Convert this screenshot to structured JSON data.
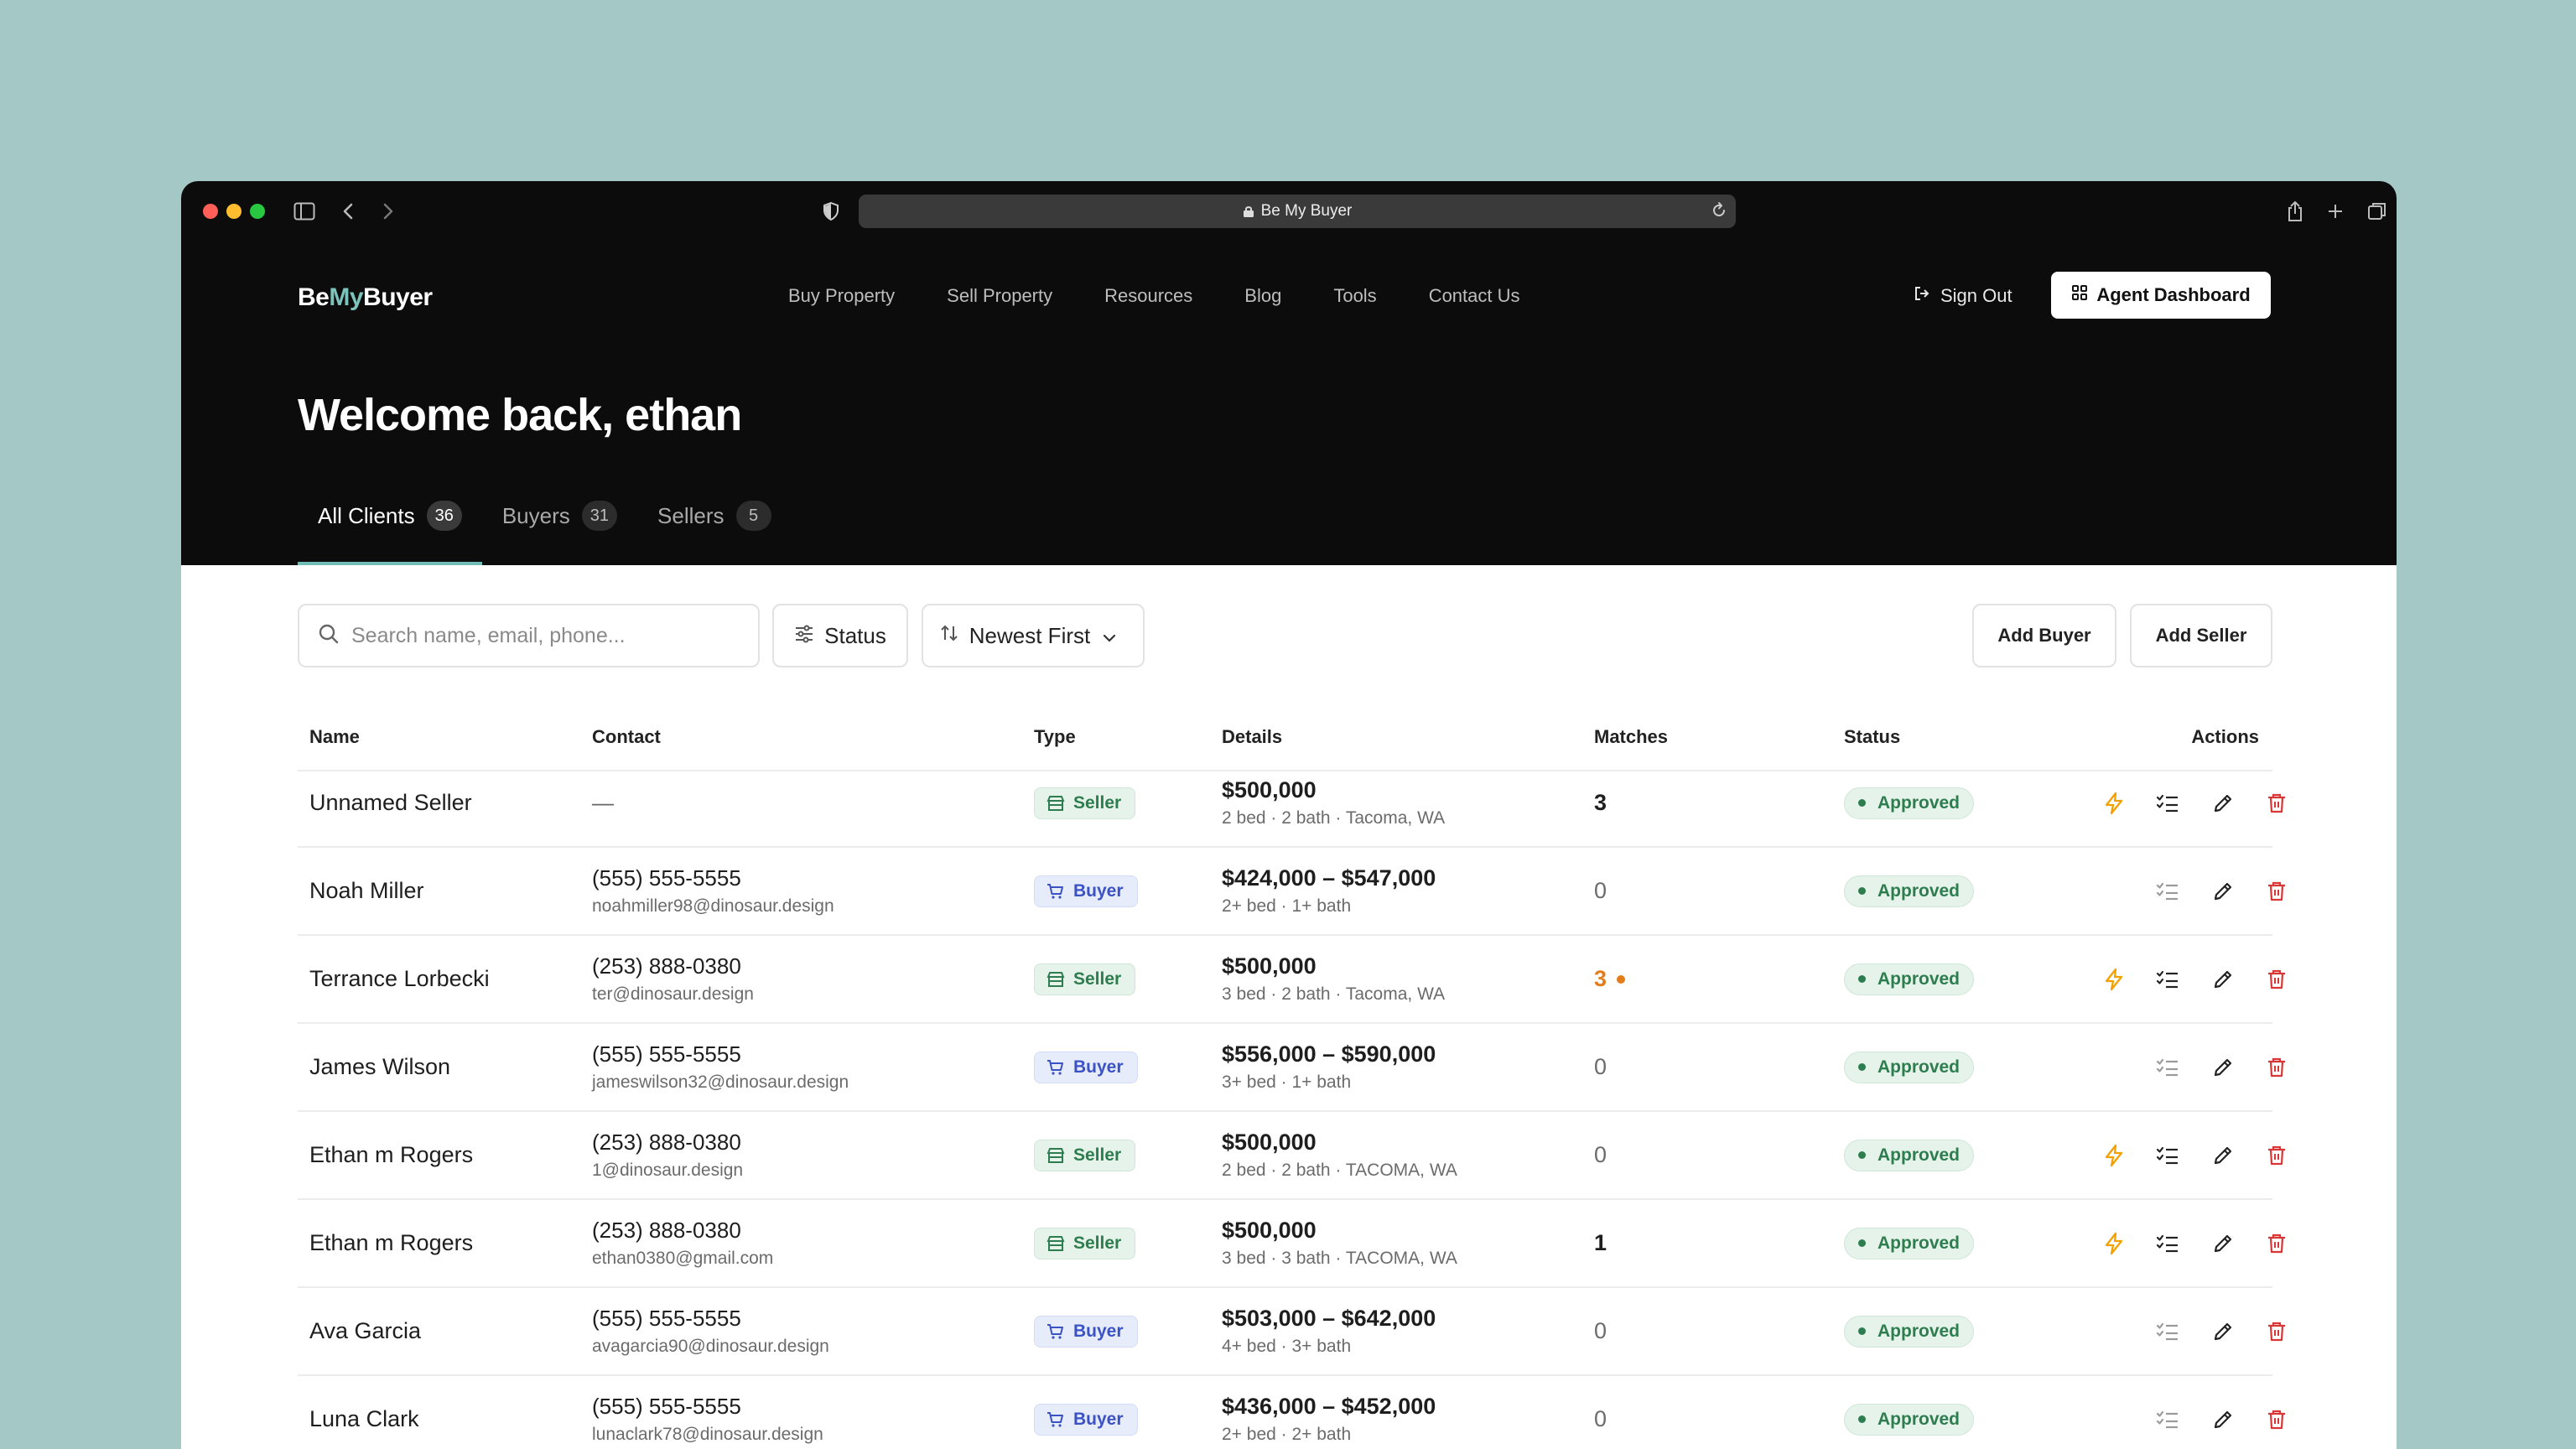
{
  "browser": {
    "url_title": "Be My Buyer"
  },
  "header": {
    "logo": {
      "part1": "Be",
      "part2": "My",
      "part3": "Buyer"
    },
    "nav": [
      "Buy Property",
      "Sell Property",
      "Resources",
      "Blog",
      "Tools",
      "Contact Us"
    ],
    "sign_out": "Sign Out",
    "agent_dashboard": "Agent Dashboard",
    "welcome": "Welcome back, ethan"
  },
  "tabs": [
    {
      "label": "All Clients",
      "count": "36",
      "active": true
    },
    {
      "label": "Buyers",
      "count": "31",
      "active": false
    },
    {
      "label": "Sellers",
      "count": "5",
      "active": false
    }
  ],
  "toolbar": {
    "search_placeholder": "Search name, email, phone...",
    "status_label": "Status",
    "sort_label": "Newest First",
    "add_buyer": "Add Buyer",
    "add_seller": "Add Seller"
  },
  "table": {
    "headers": {
      "name": "Name",
      "contact": "Contact",
      "type": "Type",
      "details": "Details",
      "matches": "Matches",
      "status": "Status",
      "actions": "Actions"
    },
    "rows": [
      {
        "name": "Unnamed Seller",
        "phone": "—",
        "email": "",
        "type": "Seller",
        "price": "$500,000",
        "spec": "2 bed · 2 bath · Tacoma, WA",
        "matches": "3",
        "match_style": "bold",
        "status": "Approved",
        "bolt": true
      },
      {
        "name": "Noah Miller",
        "phone": "(555) 555-5555",
        "email": "noahmiller98@dinosaur.design",
        "type": "Buyer",
        "price": "$424,000 – $547,000",
        "spec": "2+ bed · 1+ bath",
        "matches": "0",
        "match_style": "zero",
        "status": "Approved",
        "bolt": false
      },
      {
        "name": "Terrance Lorbecki",
        "phone": "(253) 888-0380",
        "email": "ter@dinosaur.design",
        "type": "Seller",
        "price": "$500,000",
        "spec": "3 bed · 2 bath · Tacoma, WA",
        "matches": "3",
        "match_style": "orange",
        "status": "Approved",
        "bolt": true
      },
      {
        "name": "James Wilson",
        "phone": "(555) 555-5555",
        "email": "jameswilson32@dinosaur.design",
        "type": "Buyer",
        "price": "$556,000 – $590,000",
        "spec": "3+ bed · 1+ bath",
        "matches": "0",
        "match_style": "zero",
        "status": "Approved",
        "bolt": false
      },
      {
        "name": "Ethan m Rogers",
        "phone": "(253) 888-0380",
        "email": "1@dinosaur.design",
        "type": "Seller",
        "price": "$500,000",
        "spec": "2 bed · 2 bath · TACOMA, WA",
        "matches": "0",
        "match_style": "zero",
        "status": "Approved",
        "bolt": true
      },
      {
        "name": "Ethan m Rogers",
        "phone": "(253) 888-0380",
        "email": "ethan0380@gmail.com",
        "type": "Seller",
        "price": "$500,000",
        "spec": "3 bed · 3 bath · TACOMA, WA",
        "matches": "1",
        "match_style": "bold",
        "status": "Approved",
        "bolt": true
      },
      {
        "name": "Ava Garcia",
        "phone": "(555) 555-5555",
        "email": "avagarcia90@dinosaur.design",
        "type": "Buyer",
        "price": "$503,000 – $642,000",
        "spec": "4+ bed · 3+ bath",
        "matches": "0",
        "match_style": "zero",
        "status": "Approved",
        "bolt": false
      },
      {
        "name": "Luna Clark",
        "phone": "(555) 555-5555",
        "email": "lunaclark78@dinosaur.design",
        "type": "Buyer",
        "price": "$436,000 – $452,000",
        "spec": "2+ bed · 2+ bath",
        "matches": "0",
        "match_style": "zero",
        "status": "Approved",
        "bolt": false
      }
    ]
  },
  "colors": {
    "accent": "#6fbdb5",
    "bolt": "#f2a100",
    "delete": "#d93636",
    "orange_match": "#e37d1c",
    "approved": "#2e7d4f"
  },
  "icons": [
    "sidebar-icon",
    "back-icon",
    "forward-icon",
    "shield-icon",
    "lock-icon",
    "reload-icon",
    "share-icon",
    "new-tab-icon",
    "tabs-icon",
    "sign-out-icon",
    "grid-icon",
    "search-icon",
    "filter-icon",
    "sort-icon",
    "chevron-down-icon",
    "store-icon",
    "cart-icon",
    "bolt-icon",
    "checklist-icon",
    "pencil-icon",
    "trash-icon"
  ]
}
